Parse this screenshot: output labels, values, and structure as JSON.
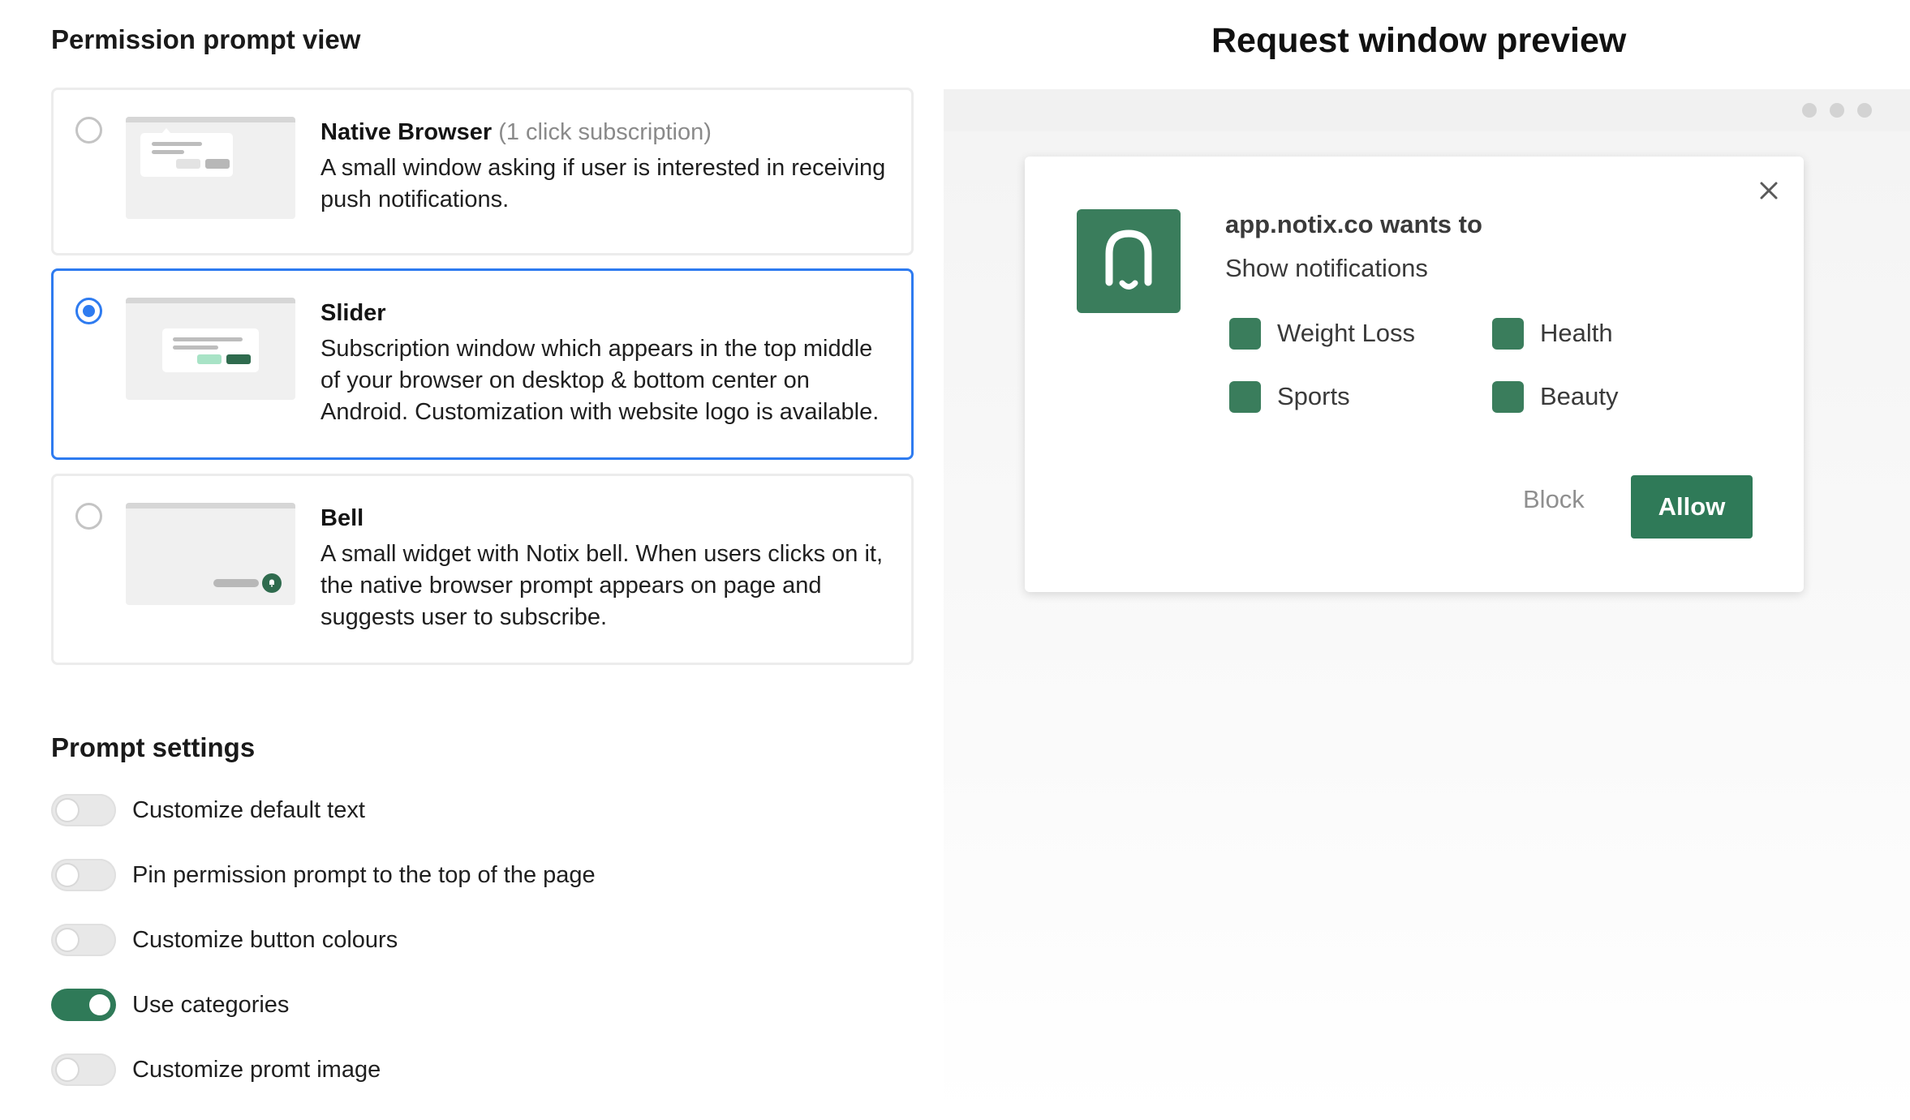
{
  "permission_section": {
    "title": "Permission prompt view",
    "options": [
      {
        "title": "Native Browser",
        "title_note": "(1 click subscription)",
        "description": "A small window asking if user is interested in receiving push notifications.",
        "selected": false
      },
      {
        "title": "Slider",
        "description": "Subscription window which appears in the top middle of your browser on desktop & bottom center on Android. Customization with website logo is available.",
        "selected": true
      },
      {
        "title": "Bell",
        "description": "A small widget with Notix bell. When users clicks on it, the native browser prompt appears on page and suggests user to subscribe.",
        "selected": false
      }
    ]
  },
  "settings_section": {
    "title": "Prompt settings",
    "toggles": [
      {
        "label": "Customize default text",
        "on": false
      },
      {
        "label": "Pin permission prompt to the top of the page",
        "on": false
      },
      {
        "label": "Customize button colours",
        "on": false
      },
      {
        "label": "Use categories",
        "on": true
      },
      {
        "label": "Customize promt image",
        "on": false
      }
    ]
  },
  "preview": {
    "title": "Request window preview",
    "prompt": {
      "heading": "app.notix.co wants to",
      "subheading": "Show notifications",
      "categories": [
        "Weight Loss",
        "Health",
        "Sports",
        "Beauty"
      ],
      "block_label": "Block",
      "allow_label": "Allow"
    }
  },
  "colors": {
    "brand_green": "#2f7a58",
    "selected_blue": "#2e7bf0",
    "slider_accent_light": "#a8e3c6"
  }
}
